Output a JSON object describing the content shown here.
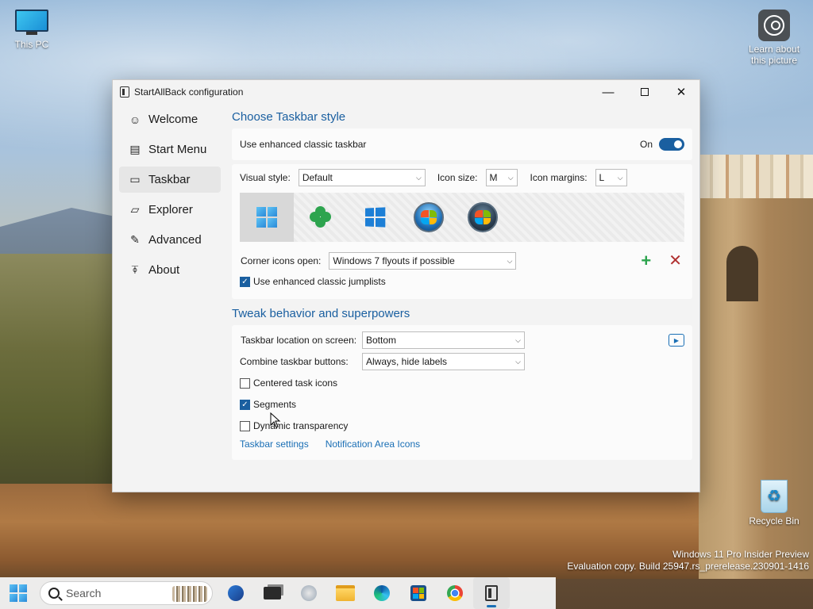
{
  "desktop": {
    "this_pc_label": "This PC",
    "learn_label": "Learn about this picture",
    "recycle_label": "Recycle Bin",
    "watermark_line1": "Windows 11 Pro Insider Preview",
    "watermark_line2": "Evaluation copy. Build 25947.rs_prerelease.230901-1416"
  },
  "window": {
    "title": "StartAllBack configuration",
    "minimize_glyph": "—",
    "close_glyph": "✕"
  },
  "sidebar": {
    "items": [
      {
        "label": "Welcome",
        "icon": "smile-icon",
        "glyph": "☺"
      },
      {
        "label": "Start Menu",
        "icon": "start-menu-icon",
        "glyph": "▤"
      },
      {
        "label": "Taskbar",
        "icon": "taskbar-icon",
        "glyph": "▭"
      },
      {
        "label": "Explorer",
        "icon": "explorer-icon",
        "glyph": "▱"
      },
      {
        "label": "Advanced",
        "icon": "wrench-icon",
        "glyph": "✎"
      },
      {
        "label": "About",
        "icon": "about-icon",
        "glyph": "⍕"
      }
    ],
    "active_index": 2
  },
  "taskbar_style": {
    "section_title": "Choose Taskbar style",
    "enhanced_label": "Use enhanced classic taskbar",
    "enhanced_state": "On",
    "visual_style_label": "Visual style:",
    "visual_style_value": "Default",
    "icon_size_label": "Icon size:",
    "icon_size_value": "M",
    "icon_margins_label": "Icon margins:",
    "icon_margins_value": "L",
    "styles": [
      "windows-11-icon",
      "clover-icon",
      "windows-10-icon",
      "windows-7-orb-icon",
      "windows-vista-orb-icon"
    ],
    "selected_style": 0,
    "corner_label": "Corner icons open:",
    "corner_value": "Windows 7 flyouts if possible",
    "jumplists_label": "Use enhanced classic jumplists",
    "jumplists_checked": true,
    "add_glyph": "+",
    "remove_glyph": "✕"
  },
  "tweaks": {
    "section_title": "Tweak behavior and superpowers",
    "location_label": "Taskbar location on screen:",
    "location_value": "Bottom",
    "combine_label": "Combine taskbar buttons:",
    "combine_value": "Always, hide labels",
    "centered_label": "Centered task icons",
    "centered_checked": false,
    "segments_label": "Segments",
    "segments_checked": true,
    "transparency_label": "Dynamic transparency",
    "transparency_checked": false,
    "link_settings": "Taskbar settings",
    "link_notification": "Notification Area Icons"
  },
  "os_taskbar": {
    "search_placeholder": "Search",
    "pinned": [
      "start-icon",
      "search",
      "insider-icon",
      "task-view-icon",
      "copilot-icon",
      "file-explorer-icon",
      "edge-icon",
      "store-icon",
      "chrome-icon",
      "startallback-icon"
    ]
  },
  "colors": {
    "accent": "#1a5fa0",
    "link": "#1a6fb5",
    "add": "#2da44e",
    "remove": "#b03030"
  }
}
